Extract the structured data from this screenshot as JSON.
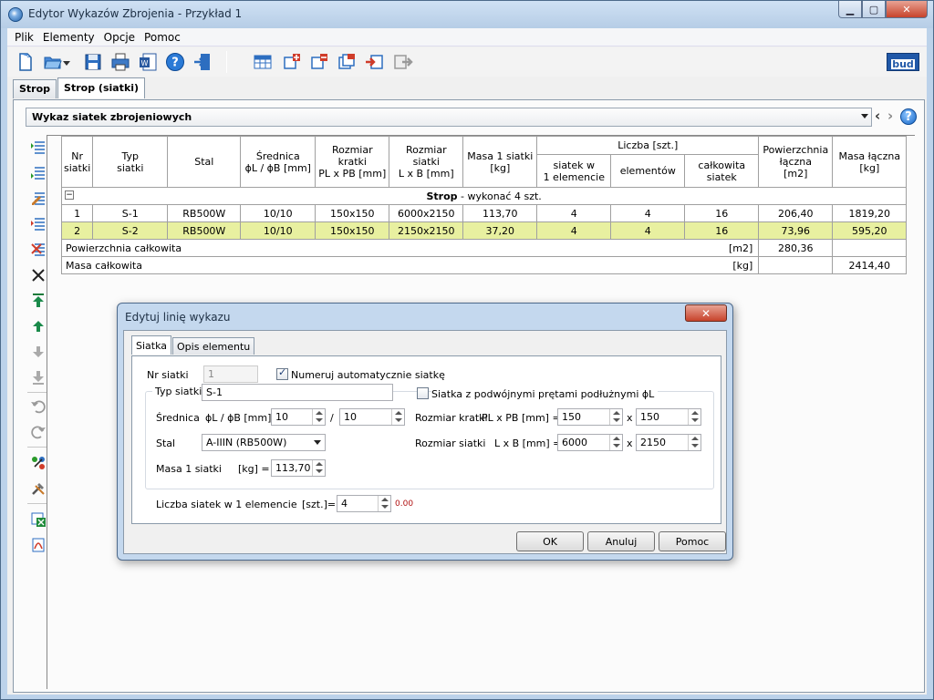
{
  "window": {
    "title": "Edytor Wykazów Zbrojenia - Przykład 1"
  },
  "menu": [
    "Plik",
    "Elementy",
    "Opcje",
    "Pomoc"
  ],
  "tabs": [
    "Strop",
    "Strop (siatki)"
  ],
  "combo": {
    "value": "Wykaz siatek zbrojeniowych"
  },
  "table": {
    "headers": {
      "nr": "Nr\nsiatki",
      "typ": "Typ\nsiatki",
      "stal": "Stal",
      "srednica": "Średnica\nϕL / ϕB [mm]",
      "kratka": "Rozmiar kratki\nPL x PB [mm]",
      "rozmiar": "Rozmiar siatki\nL x B [mm]",
      "masa1": "Masa 1 siatki\n[kg]",
      "liczba": "Liczba [szt.]",
      "siatek_w": "siatek w\n1 elemencie",
      "elementow": "elementów",
      "calkowita": "całkowita\nsiatek",
      "pow": "Powierzchnia\nłączna\n[m2]",
      "masa_l": "Masa łączna\n[kg]"
    },
    "group": {
      "name": "Strop",
      "suffix": " - wykonać 4 szt.",
      "toggle": "−"
    },
    "rows": [
      {
        "nr": "1",
        "typ": "S-1",
        "stal": "RB500W",
        "sr": "10/10",
        "kratka": "150x150",
        "rozmiar": "6000x2150",
        "masa1": "113,70",
        "siatek": "4",
        "elem": "4",
        "calk": "16",
        "pow": "206,40",
        "masa": "1819,20"
      },
      {
        "nr": "2",
        "typ": "S-2",
        "stal": "RB500W",
        "sr": "10/10",
        "kratka": "150x150",
        "rozmiar": "2150x2150",
        "masa1": "37,20",
        "siatek": "4",
        "elem": "4",
        "calk": "16",
        "pow": "73,96",
        "masa": "595,20"
      }
    ],
    "summary": {
      "pow_label": "Powierzchnia całkowita",
      "pow_unit": "[m2]",
      "pow_value": "280,36",
      "masa_label": "Masa całkowita",
      "masa_unit": "[kg]",
      "masa_value": "2414,40"
    }
  },
  "dialog": {
    "title": "Edytuj linię wykazu",
    "close": "✕",
    "tabs": [
      "Siatka",
      "Opis elementu"
    ],
    "nr_label": "Nr siatki",
    "nr_value": "1",
    "auto_label": "Numeruj automatycznie siatkę",
    "auto_checked": true,
    "typ_label": "Typ siatki",
    "typ_value": "S-1",
    "double_label": "Siatka z podwójnymi prętami podłużnymi ϕL",
    "double_checked": false,
    "srednica_label": "Średnica",
    "srednica_units": "ϕL / ϕB [mm] =",
    "srednica_l": "10",
    "srednica_sep": "/",
    "srednica_b": "10",
    "stal_label": "Stal",
    "stal_value": "A-IIIN (RB500W)",
    "masa_label": "Masa 1 siatki",
    "masa_units": "[kg] =",
    "masa_value": "113,70",
    "kratka_label": "Rozmiar kratki",
    "kratka_units": "PL x PB [mm] =",
    "kratka_l": "150",
    "kratka_x": "x",
    "kratka_b": "150",
    "rozmiar_label": "Rozmiar siatki",
    "rozmiar_units": "L x B [mm] =",
    "rozmiar_l": "6000",
    "rozmiar_x": "x",
    "rozmiar_b": "2150",
    "liczba_label": "Liczba siatek w 1 elemencie",
    "liczba_units": "[szt.]=",
    "liczba_value": "4",
    "liczba_extra": "0.00",
    "ok": "OK",
    "cancel": "Anuluj",
    "help": "Pomoc"
  },
  "logo": {
    "text": "bud"
  },
  "colors": {
    "selected_row": "#e8f0a0",
    "title_bar": "#bcd2ea"
  }
}
